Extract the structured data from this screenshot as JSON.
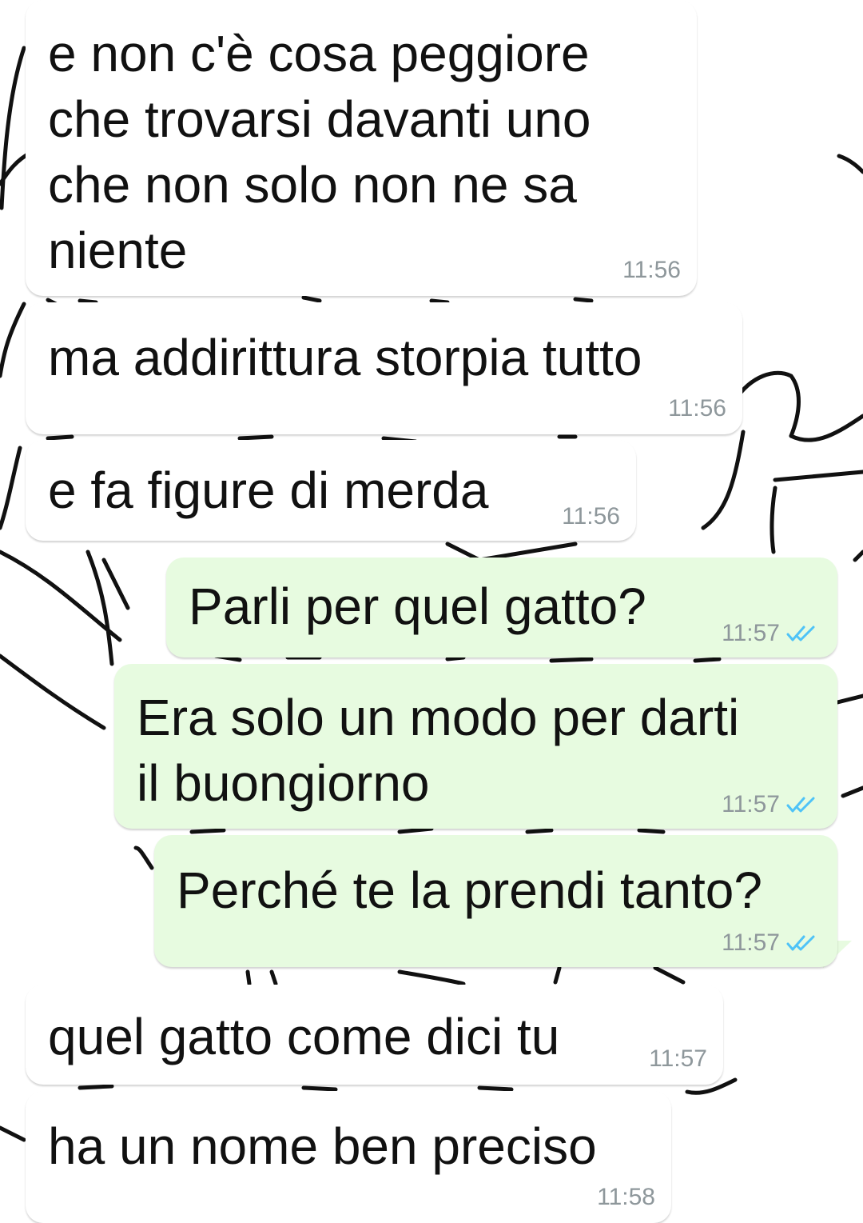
{
  "chat": {
    "messages": [
      {
        "direction": "incoming",
        "lines": [
          "e non c'è cosa peggiore",
          "che trovarsi davanti uno",
          "che non solo non ne sa",
          "niente"
        ],
        "time": "11:56"
      },
      {
        "direction": "incoming",
        "lines": [
          "ma addirittura storpia tutto"
        ],
        "time": "11:56"
      },
      {
        "direction": "incoming",
        "lines": [
          "e fa figure di merda"
        ],
        "time": "11:56"
      },
      {
        "direction": "outgoing",
        "lines": [
          "Parli per quel gatto?"
        ],
        "time": "11:57",
        "status_icon": "double-check-icon"
      },
      {
        "direction": "outgoing",
        "lines": [
          "Era solo un modo per darti",
          "il buongiorno"
        ],
        "time": "11:57",
        "status_icon": "double-check-icon"
      },
      {
        "direction": "outgoing",
        "lines": [
          "Perché te la prendi tanto?"
        ],
        "time": "11:57",
        "status_icon": "double-check-icon"
      },
      {
        "direction": "incoming",
        "lines": [
          "quel gatto come dici tu"
        ],
        "time": "11:57"
      },
      {
        "direction": "incoming",
        "lines": [
          "ha un nome ben preciso"
        ],
        "time": "11:58"
      }
    ]
  },
  "colors": {
    "incoming_bubble": "#ffffff",
    "outgoing_bubble": "#e7fbe0",
    "message_text": "#111111",
    "timestamp": "#8e979b",
    "read_ticks": "#4fc3f7",
    "wallpaper_lines": "#111111"
  }
}
